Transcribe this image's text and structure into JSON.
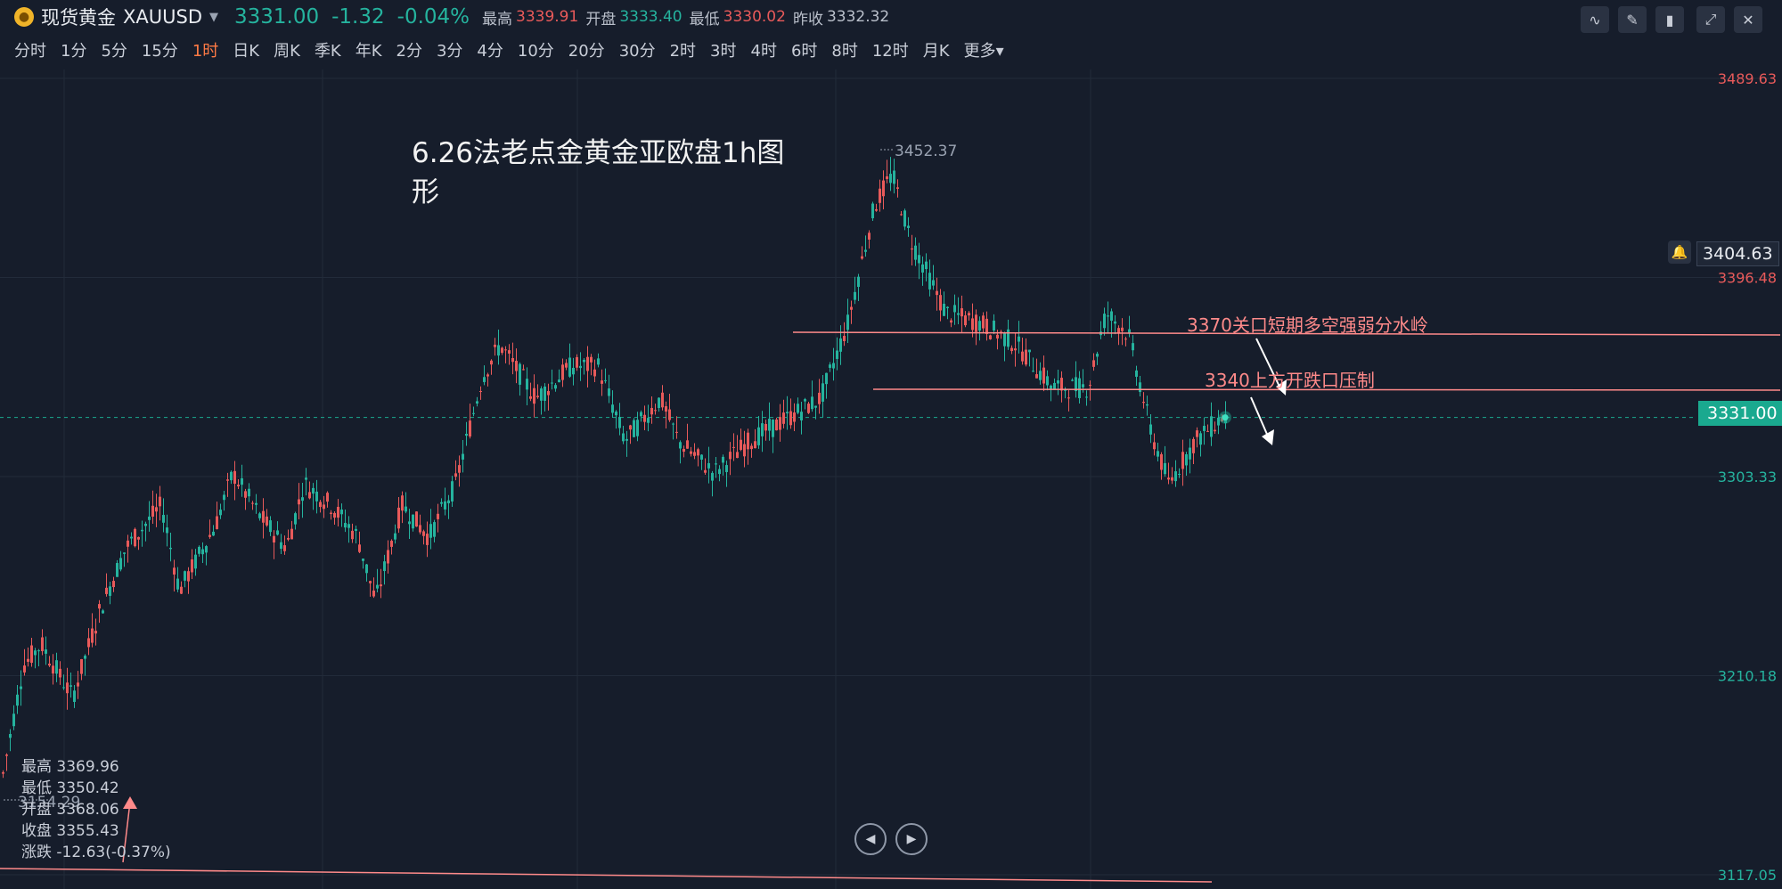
{
  "header": {
    "name": "现货黄金",
    "symbol": "XAUUSD",
    "price": "3331.00",
    "change": "-1.32",
    "change_pct": "-0.04%",
    "high_label": "最高",
    "high": "3339.91",
    "open_label": "开盘",
    "open": "3333.40",
    "low_label": "最低",
    "low": "3330.02",
    "prev_label": "昨收",
    "prev": "3332.32"
  },
  "periods": [
    "分时",
    "1分",
    "5分",
    "15分",
    "1时",
    "日K",
    "周K",
    "季K",
    "年K",
    "2分",
    "3分",
    "4分",
    "10分",
    "20分",
    "30分",
    "2时",
    "3时",
    "4时",
    "6时",
    "8时",
    "12时",
    "月K",
    "更多"
  ],
  "active_period": "1时",
  "y_axis": {
    "labels": [
      "3489.63",
      "3396.48",
      "3303.33",
      "3210.18",
      "3117.05"
    ],
    "alert_price": "3404.63",
    "current_price": "3331.00"
  },
  "chart_marks": {
    "peak_label": "3452.37",
    "low_label": "3154.29"
  },
  "annotations": {
    "title": "6.26法老点金黄金亚欧盘1h图形",
    "line1": "3370关口短期多空强弱分水岭",
    "line2": "3340上方开跌口压制"
  },
  "info_panel": {
    "high": "最高 3369.96",
    "low": "最低 3350.42",
    "open": "开盘 3368.06",
    "close": "收盘 3355.43",
    "change": "涨跌 -12.63(-0.37%)"
  },
  "colors": {
    "up": "#e85a5a",
    "down": "#25b39e",
    "bg": "#161d2b",
    "accent": "#ff7a45"
  },
  "icons": {
    "indicator": "chart-line-icon",
    "draw": "pencil-icon",
    "candles": "candlestick-icon",
    "expand": "expand-icon",
    "close": "close-icon",
    "alert": "bell-icon"
  }
}
